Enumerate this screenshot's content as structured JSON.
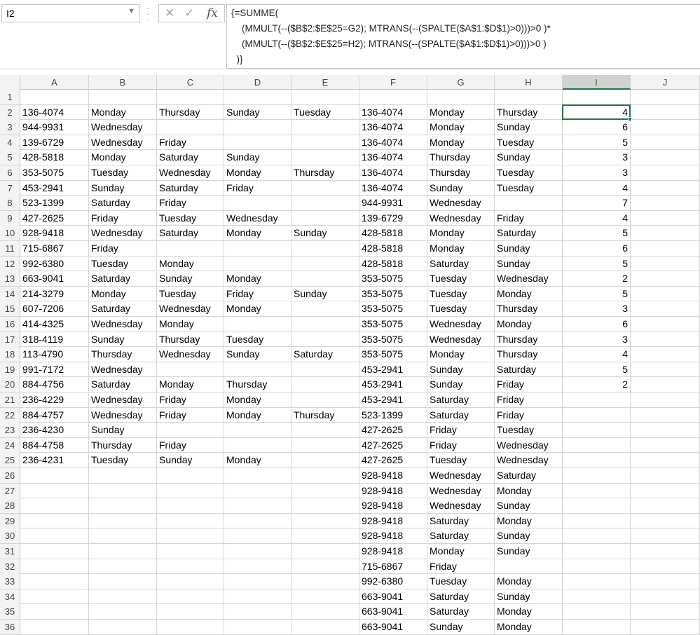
{
  "formula_bar": {
    "name_box": "I2",
    "formula_lines": [
      "{=SUMME(",
      "    (MMULT(--($B$2:$E$25=G2); MTRANS(--(SPALTE($A$1:$D$1)>0)))>0 )*",
      "    (MMULT(--($B$2:$E$25=H2); MTRANS(--(SPALTE($A$1:$D$1)>0)))>0 )",
      "  )}"
    ],
    "icons": [
      "cancel-icon",
      "enter-icon",
      "function-icon"
    ]
  },
  "sheet": {
    "columns": [
      "A",
      "B",
      "C",
      "D",
      "E",
      "F",
      "G",
      "H",
      "I",
      "J"
    ],
    "selected_column": "I",
    "selected_cell": "I2",
    "rows": [
      {
        "n": "1",
        "cells": [
          "",
          "",
          "",
          "",
          "",
          "",
          "",
          "",
          "",
          ""
        ]
      },
      {
        "n": "2",
        "cells": [
          "136-4074",
          "Monday",
          "Thursday",
          "Sunday",
          "Tuesday",
          "136-4074",
          "Monday",
          "Thursday",
          "4",
          ""
        ]
      },
      {
        "n": "3",
        "cells": [
          "944-9931",
          "Wednesday",
          "",
          "",
          "",
          "136-4074",
          "Monday",
          "Sunday",
          "6",
          ""
        ]
      },
      {
        "n": "4",
        "cells": [
          "139-6729",
          "Wednesday",
          "Friday",
          "",
          "",
          "136-4074",
          "Monday",
          "Tuesday",
          "5",
          ""
        ]
      },
      {
        "n": "5",
        "cells": [
          "428-5818",
          "Monday",
          "Saturday",
          "Sunday",
          "",
          "136-4074",
          "Thursday",
          "Sunday",
          "3",
          ""
        ]
      },
      {
        "n": "6",
        "cells": [
          "353-5075",
          "Tuesday",
          "Wednesday",
          "Monday",
          "Thursday",
          "136-4074",
          "Thursday",
          "Tuesday",
          "3",
          ""
        ]
      },
      {
        "n": "7",
        "cells": [
          "453-2941",
          "Sunday",
          "Saturday",
          "Friday",
          "",
          "136-4074",
          "Sunday",
          "Tuesday",
          "4",
          ""
        ]
      },
      {
        "n": "8",
        "cells": [
          "523-1399",
          "Saturday",
          "Friday",
          "",
          "",
          "944-9931",
          "Wednesday",
          "",
          "7",
          ""
        ]
      },
      {
        "n": "9",
        "cells": [
          "427-2625",
          "Friday",
          "Tuesday",
          "Wednesday",
          "",
          "139-6729",
          "Wednesday",
          "Friday",
          "4",
          ""
        ]
      },
      {
        "n": "10",
        "cells": [
          "928-9418",
          "Wednesday",
          "Saturday",
          "Monday",
          "Sunday",
          "428-5818",
          "Monday",
          "Saturday",
          "5",
          ""
        ]
      },
      {
        "n": "11",
        "cells": [
          "715-6867",
          "Friday",
          "",
          "",
          "",
          "428-5818",
          "Monday",
          "Sunday",
          "6",
          ""
        ]
      },
      {
        "n": "12",
        "cells": [
          "992-6380",
          "Tuesday",
          "Monday",
          "",
          "",
          "428-5818",
          "Saturday",
          "Sunday",
          "5",
          ""
        ]
      },
      {
        "n": "13",
        "cells": [
          "663-9041",
          "Saturday",
          "Sunday",
          "Monday",
          "",
          "353-5075",
          "Tuesday",
          "Wednesday",
          "2",
          ""
        ]
      },
      {
        "n": "14",
        "cells": [
          "214-3279",
          "Monday",
          "Tuesday",
          "Friday",
          "Sunday",
          "353-5075",
          "Tuesday",
          "Monday",
          "5",
          ""
        ]
      },
      {
        "n": "15",
        "cells": [
          "607-7206",
          "Saturday",
          "Wednesday",
          "Monday",
          "",
          "353-5075",
          "Tuesday",
          "Thursday",
          "3",
          ""
        ]
      },
      {
        "n": "16",
        "cells": [
          "414-4325",
          "Wednesday",
          "Monday",
          "",
          "",
          "353-5075",
          "Wednesday",
          "Monday",
          "6",
          ""
        ]
      },
      {
        "n": "17",
        "cells": [
          "318-4119",
          "Sunday",
          "Thursday",
          "Tuesday",
          "",
          "353-5075",
          "Wednesday",
          "Thursday",
          "3",
          ""
        ]
      },
      {
        "n": "18",
        "cells": [
          "113-4790",
          "Thursday",
          "Wednesday",
          "Sunday",
          "Saturday",
          "353-5075",
          "Monday",
          "Thursday",
          "4",
          ""
        ]
      },
      {
        "n": "19",
        "cells": [
          "991-7172",
          "Wednesday",
          "",
          "",
          "",
          "453-2941",
          "Sunday",
          "Saturday",
          "5",
          ""
        ]
      },
      {
        "n": "20",
        "cells": [
          "884-4756",
          "Saturday",
          "Monday",
          "Thursday",
          "",
          "453-2941",
          "Sunday",
          "Friday",
          "2",
          ""
        ]
      },
      {
        "n": "21",
        "cells": [
          "236-4229",
          "Wednesday",
          "Friday",
          "Monday",
          "",
          "453-2941",
          "Saturday",
          "Friday",
          "",
          ""
        ]
      },
      {
        "n": "22",
        "cells": [
          "884-4757",
          "Wednesday",
          "Friday",
          "Monday",
          "Thursday",
          "523-1399",
          "Saturday",
          "Friday",
          "",
          ""
        ]
      },
      {
        "n": "23",
        "cells": [
          "236-4230",
          "Sunday",
          "",
          "",
          "",
          "427-2625",
          "Friday",
          "Tuesday",
          "",
          ""
        ]
      },
      {
        "n": "24",
        "cells": [
          "884-4758",
          "Thursday",
          "Friday",
          "",
          "",
          "427-2625",
          "Friday",
          "Wednesday",
          "",
          ""
        ]
      },
      {
        "n": "25",
        "cells": [
          "236-4231",
          "Tuesday",
          "Sunday",
          "Monday",
          "",
          "427-2625",
          "Tuesday",
          "Wednesday",
          "",
          ""
        ]
      },
      {
        "n": "26",
        "cells": [
          "",
          "",
          "",
          "",
          "",
          "928-9418",
          "Wednesday",
          "Saturday",
          "",
          ""
        ]
      },
      {
        "n": "27",
        "cells": [
          "",
          "",
          "",
          "",
          "",
          "928-9418",
          "Wednesday",
          "Monday",
          "",
          ""
        ]
      },
      {
        "n": "28",
        "cells": [
          "",
          "",
          "",
          "",
          "",
          "928-9418",
          "Wednesday",
          "Sunday",
          "",
          ""
        ]
      },
      {
        "n": "29",
        "cells": [
          "",
          "",
          "",
          "",
          "",
          "928-9418",
          "Saturday",
          "Monday",
          "",
          ""
        ]
      },
      {
        "n": "30",
        "cells": [
          "",
          "",
          "",
          "",
          "",
          "928-9418",
          "Saturday",
          "Sunday",
          "",
          ""
        ]
      },
      {
        "n": "31",
        "cells": [
          "",
          "",
          "",
          "",
          "",
          "928-9418",
          "Monday",
          "Sunday",
          "",
          ""
        ]
      },
      {
        "n": "32",
        "cells": [
          "",
          "",
          "",
          "",
          "",
          "715-6867",
          "Friday",
          "",
          "",
          ""
        ]
      },
      {
        "n": "33",
        "cells": [
          "",
          "",
          "",
          "",
          "",
          "992-6380",
          "Tuesday",
          "Monday",
          "",
          ""
        ]
      },
      {
        "n": "34",
        "cells": [
          "",
          "",
          "",
          "",
          "",
          "663-9041",
          "Saturday",
          "Sunday",
          "",
          ""
        ]
      },
      {
        "n": "35",
        "cells": [
          "",
          "",
          "",
          "",
          "",
          "663-9041",
          "Saturday",
          "Monday",
          "",
          ""
        ]
      },
      {
        "n": "36",
        "cells": [
          "",
          "",
          "",
          "",
          "",
          "663-9041",
          "Sunday",
          "Monday",
          "",
          ""
        ]
      }
    ]
  },
  "colors": {
    "accent": "#217346",
    "header_bg": "#f3f3f3",
    "gridline": "#d4d4d4"
  }
}
